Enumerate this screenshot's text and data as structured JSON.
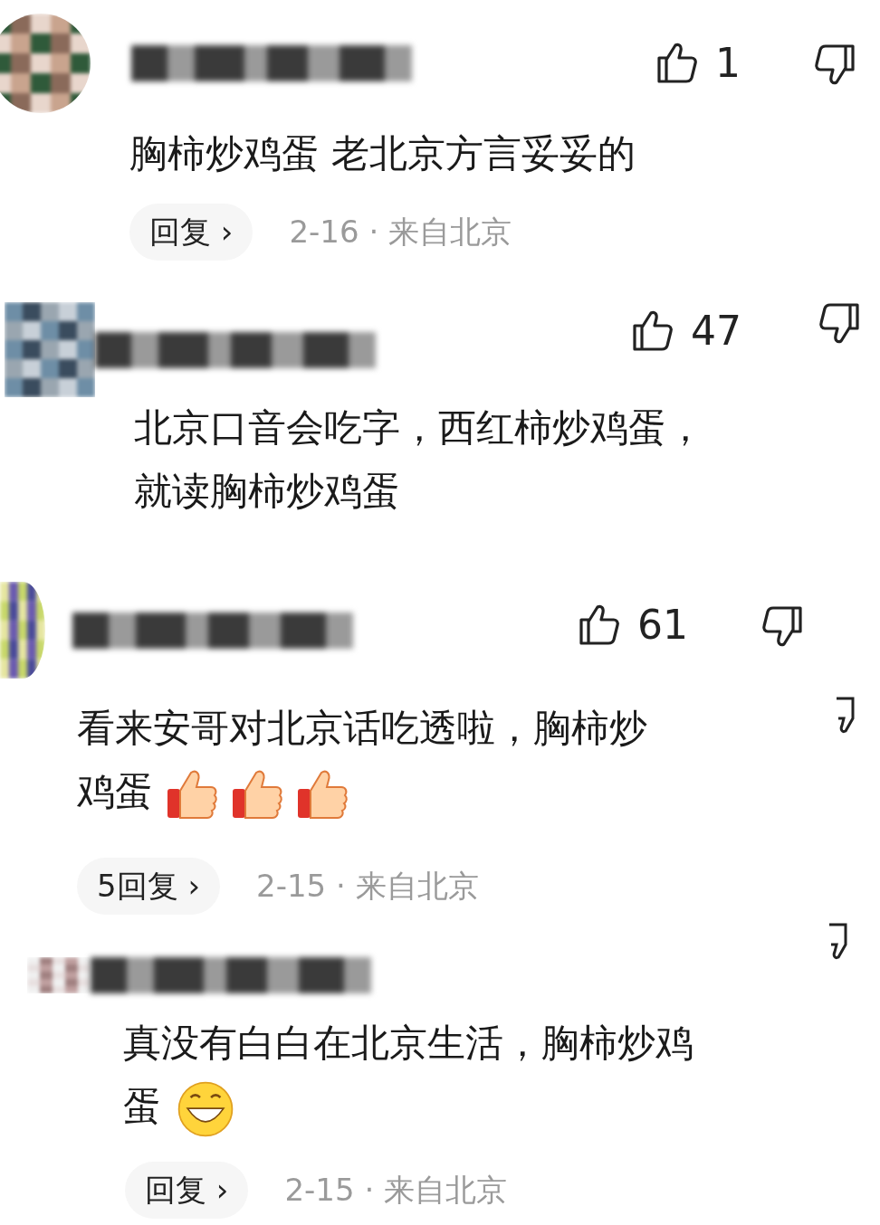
{
  "comments": [
    {
      "likes": "1",
      "lines": [
        "胸柿炒鸡蛋 老北京方言妥妥的"
      ],
      "reply_label": "回复 ›",
      "date": "2-16 · 来自北京"
    },
    {
      "likes": "47",
      "lines": [
        "北京口音会吃字，西红柿炒鸡蛋，",
        "就读胸柿炒鸡蛋"
      ]
    },
    {
      "likes": "61",
      "side_icon": true,
      "lines": [
        "看来安哥对北京话吃透啦，胸柿炒",
        "鸡蛋"
      ],
      "emojis": [
        {
          "kind": "thumbs"
        },
        {
          "kind": "thumbs"
        },
        {
          "kind": "thumbs"
        }
      ],
      "reply_label": "5回复 ›",
      "date": "2-15 · 来自北京"
    },
    {
      "side_icon": true,
      "lines": [
        "真没有白白在北京生活，胸柿炒鸡",
        "蛋"
      ],
      "emojis": [
        {
          "kind": "grin"
        }
      ],
      "reply_label": "回复 ›",
      "date": "2-15 · 来自北京"
    }
  ]
}
